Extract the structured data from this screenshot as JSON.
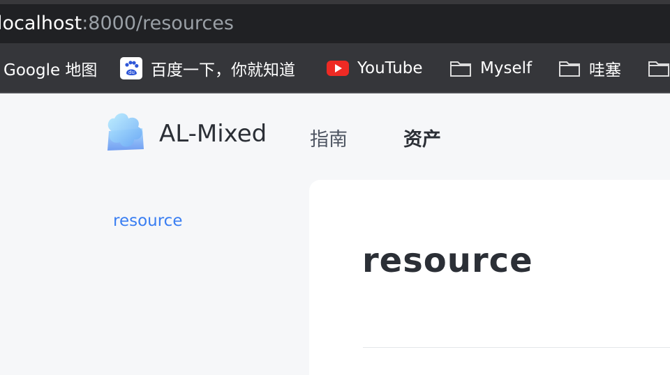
{
  "browser": {
    "url_host": "localhost",
    "url_path": ":8000/resources",
    "bookmarks": [
      {
        "label": "Google 地图",
        "icon": "none"
      },
      {
        "label": "百度一下，你就知道",
        "icon": "baidu-icon"
      },
      {
        "label": "YouTube",
        "icon": "youtube-icon"
      },
      {
        "label": "Myself",
        "icon": "folder-icon"
      },
      {
        "label": "哇塞",
        "icon": "folder-icon"
      },
      {
        "label": "",
        "icon": "folder-icon"
      }
    ]
  },
  "site": {
    "brand": "AL-Mixed",
    "nav": [
      {
        "label": "指南"
      },
      {
        "label": "资产"
      }
    ]
  },
  "sidebar": {
    "items": [
      {
        "label": "resource"
      }
    ]
  },
  "main": {
    "title": "resource"
  },
  "colors": {
    "accent": "#3a7ef2",
    "youtube": "#ee2a24"
  }
}
